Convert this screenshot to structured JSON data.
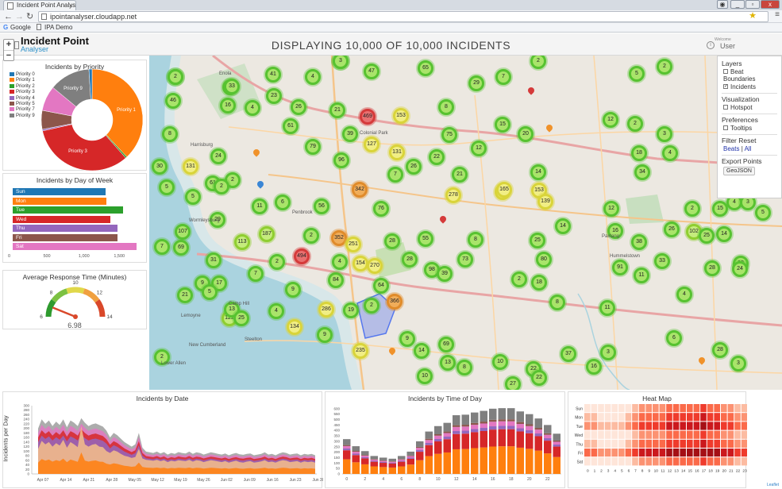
{
  "browser": {
    "tab_title": "Incident Point Analys",
    "url": "ipointanalyser.cloudapp.net",
    "bookmarks": [
      "Google",
      "IPA Demo"
    ]
  },
  "header": {
    "logo_title": "Incident Point",
    "logo_subtitle": "Analyser",
    "page_title": "DISPLAYING 10,000 OF 10,000 INCIDENTS",
    "welcome": "Welcome",
    "user": "User"
  },
  "zoom": {
    "in": "+",
    "out": "−"
  },
  "layers_panel": {
    "layers_heading": "Layers",
    "beat_boundaries": "Beat Boundaries",
    "incidents": "Incidents",
    "visualization_heading": "Visualization",
    "hotspot": "Hotspot",
    "preferences_heading": "Preferences",
    "tooltips": "Tooltips",
    "filter_reset_heading": "Filter Reset",
    "beats_link": "Beats",
    "separator": "|",
    "all_link": "All",
    "export_heading": "Export Points",
    "geojson_button": "GeoJSON"
  },
  "map": {
    "attribution": "Leaflet",
    "labels": [
      "Colonial Park",
      "Harrisburg",
      "Penbrook",
      "Lemoyne",
      "New Cumberland",
      "Lower Allen",
      "Enola",
      "Wormleysburg",
      "Hummelstown",
      "Paxtang",
      "Steelton",
      "Camp Hill"
    ],
    "cluster_counts": [
      "26",
      "2",
      "27",
      "41",
      "4",
      "47",
      "65",
      "29",
      "7",
      "2",
      "5",
      "2",
      "33",
      "23",
      "46",
      "16",
      "4",
      "26",
      "21",
      "469",
      "153",
      "8",
      "15",
      "2",
      "3",
      "8",
      "61",
      "39",
      "127",
      "75",
      "12",
      "20",
      "12",
      "4",
      "2",
      "79",
      "96",
      "131",
      "22",
      "18",
      "30",
      "131",
      "24",
      "61",
      "2",
      "7",
      "26",
      "21",
      "191",
      "14",
      "34",
      "5",
      "5",
      "2",
      "11",
      "6",
      "56",
      "342",
      "76",
      "278",
      "165",
      "153",
      "139",
      "12",
      "2",
      "4",
      "15",
      "3",
      "5",
      "29",
      "107",
      "7",
      "113",
      "187",
      "2",
      "352",
      "251",
      "28",
      "55",
      "8",
      "25",
      "14",
      "16",
      "38",
      "26",
      "102",
      "25",
      "14",
      "12",
      "69",
      "31",
      "2",
      "494",
      "4",
      "154",
      "270",
      "28",
      "73",
      "80",
      "91",
      "11",
      "33",
      "28",
      "122",
      "9",
      "17",
      "7",
      "9",
      "84",
      "64",
      "98",
      "2",
      "24",
      "5",
      "13",
      "2",
      "366",
      "39",
      "18",
      "8",
      "11",
      "4",
      "4",
      "134",
      "286",
      "9",
      "19",
      "235",
      "9",
      "14",
      "69",
      "13",
      "37",
      "16",
      "22",
      "3",
      "6",
      "28",
      "10",
      "8",
      "10",
      "27",
      "22",
      "3",
      "2",
      "25",
      "21",
      "3",
      "2"
    ],
    "cluster_colors": [
      "green",
      "yellow",
      "orange",
      "red"
    ]
  },
  "priority_panel": {
    "title": "Incidents by Priority",
    "legend": [
      "Priority 0",
      "Priority 1",
      "Priority 2",
      "Priority 3",
      "Priority 4",
      "Priority 5",
      "Priority 7",
      "Priority 9"
    ],
    "slice_labels": [
      "Priority 9",
      "Priority 1",
      "Priority 3"
    ],
    "colors": [
      "#1f77b4",
      "#ff7f0e",
      "#2ca02c",
      "#d62728",
      "#9467bd",
      "#8c564b",
      "#e377c2",
      "#7f7f7f"
    ]
  },
  "dow_panel": {
    "title": "Incidents by Day of Week",
    "axis_ticks": [
      "0",
      "500",
      "1,000",
      "1,500"
    ]
  },
  "response_panel": {
    "title": "Average Response Time (Minutes)",
    "ticks": [
      "6",
      "8",
      "10",
      "12",
      "14"
    ],
    "value": "6.98"
  },
  "date_panel": {
    "title": "Incidents by Date",
    "ylabel": "Incidents per Day",
    "y_ticks": [
      "0",
      "20",
      "40",
      "60",
      "80",
      "100",
      "120",
      "140",
      "160",
      "180",
      "200",
      "220",
      "240",
      "260",
      "280",
      "300"
    ],
    "x_ticks": [
      "Apr 07",
      "Apr 14",
      "Apr 21",
      "Apr 28",
      "May 05",
      "May 12",
      "May 19",
      "May 26",
      "Jun 02",
      "Jun 09",
      "Jun 16",
      "Jun 23",
      "Jun 30"
    ]
  },
  "time_panel": {
    "title": "Incidents by Time of Day",
    "y_ticks": [
      "0",
      "50",
      "100",
      "150",
      "200",
      "250",
      "300",
      "350",
      "400",
      "450",
      "500",
      "550",
      "600"
    ],
    "x_ticks": [
      "0",
      "2",
      "4",
      "6",
      "8",
      "10",
      "12",
      "14",
      "16",
      "18",
      "20",
      "22"
    ]
  },
  "heat_panel": {
    "title": "Heat Map",
    "rows": [
      "Sun",
      "Mon",
      "Tue",
      "Wed",
      "Thu",
      "Fri",
      "Sat"
    ],
    "cols": [
      "0",
      "1",
      "2",
      "3",
      "4",
      "5",
      "6",
      "7",
      "8",
      "9",
      "10",
      "11",
      "12",
      "13",
      "14",
      "15",
      "16",
      "17",
      "18",
      "19",
      "20",
      "21",
      "22",
      "23"
    ]
  },
  "chart_data": [
    {
      "type": "pie",
      "title": "Incidents by Priority",
      "categories": [
        "Priority 0",
        "Priority 1",
        "Priority 2",
        "Priority 3",
        "Priority 4",
        "Priority 5",
        "Priority 7",
        "Priority 9"
      ],
      "values": [
        1,
        38,
        0.5,
        33,
        0.5,
        6,
        8,
        13
      ]
    },
    {
      "type": "bar",
      "title": "Incidents by Day of Week",
      "categories": [
        "Sun",
        "Mon",
        "Tue",
        "Wed",
        "Thu",
        "Fri",
        "Sat"
      ],
      "values": [
        1320,
        1330,
        1560,
        1380,
        1480,
        1490,
        1760
      ],
      "colors": [
        "#1f77b4",
        "#ff7f0e",
        "#2ca02c",
        "#d62728",
        "#9467bd",
        "#8c564b",
        "#e377c2"
      ],
      "xlim": [
        0,
        1800
      ]
    },
    {
      "type": "line",
      "title": "Average Response Time (Minutes)",
      "min": 6,
      "max": 14,
      "value": 6.98
    },
    {
      "type": "area",
      "title": "Incidents by Date",
      "ylabel": "Incidents per Day",
      "ylim": [
        0,
        300
      ],
      "series": [
        {
          "values": [
            110,
            145,
            130,
            140,
            120,
            135,
            125,
            150,
            115,
            140,
            130,
            118,
            210,
            130,
            120,
            128,
            132,
            120,
            118,
            100,
            92,
            104,
            98,
            88,
            80,
            76,
            70,
            74,
            110,
            68,
            62,
            60,
            58,
            62,
            56,
            60,
            52,
            58,
            55,
            60,
            58,
            56,
            62,
            54,
            60,
            58,
            52,
            56,
            60,
            58,
            55,
            52,
            56,
            50,
            54,
            58,
            52,
            50,
            54,
            56,
            50,
            52,
            55,
            60,
            52,
            54,
            50,
            56,
            60,
            58,
            52,
            54,
            56,
            50,
            55,
            52,
            54,
            50
          ]
        },
        {
          "values": [
            200,
            240,
            220,
            235,
            210,
            230,
            215,
            240,
            205,
            235,
            225,
            210,
            245,
            225,
            210,
            218,
            222,
            215,
            208,
            190,
            160,
            180,
            170,
            155,
            140,
            130,
            120,
            130,
            180,
            115,
            98,
            95,
            92,
            98,
            90,
            96,
            85,
            92,
            88,
            96,
            92,
            90,
            98,
            88,
            95,
            92,
            85,
            90,
            95,
            92,
            88,
            85,
            90,
            82,
            88,
            92,
            86,
            84,
            88,
            90,
            82,
            85,
            88,
            95,
            85,
            88,
            82,
            90,
            95,
            92,
            85,
            88,
            90,
            82,
            88,
            85,
            88,
            82
          ]
        }
      ]
    },
    {
      "type": "bar",
      "title": "Incidents by Time of Day",
      "categories": [
        "0",
        "1",
        "2",
        "3",
        "4",
        "5",
        "6",
        "7",
        "8",
        "9",
        "10",
        "11",
        "12",
        "13",
        "14",
        "15",
        "16",
        "17",
        "18",
        "19",
        "20",
        "21",
        "22",
        "23"
      ],
      "values": [
        320,
        255,
        210,
        165,
        150,
        140,
        165,
        205,
        300,
        390,
        440,
        470,
        540,
        545,
        565,
        580,
        600,
        605,
        605,
        575,
        550,
        510,
        450,
        370
      ],
      "ylim": [
        0,
        650
      ]
    },
    {
      "type": "heatmap",
      "title": "Heat Map",
      "rows": [
        "Sun",
        "Mon",
        "Tue",
        "Wed",
        "Thu",
        "Fri",
        "Sat"
      ],
      "cols": [
        "0",
        "1",
        "2",
        "3",
        "4",
        "5",
        "6",
        "7",
        "8",
        "9",
        "10",
        "11",
        "12",
        "13",
        "14",
        "15",
        "16",
        "17",
        "18",
        "19",
        "20",
        "21",
        "22",
        "23"
      ]
    }
  ]
}
